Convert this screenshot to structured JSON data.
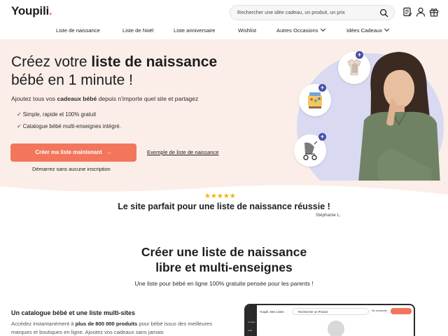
{
  "header": {
    "logo": "Youpili",
    "logo_dot": ".",
    "search_placeholder": "Rechercher une idée cadeau, un produit, un prix",
    "icons": [
      "search-icon",
      "list-icon",
      "user-icon",
      "gift-icon"
    ]
  },
  "nav": {
    "items": [
      {
        "label": "Liste de naissance"
      },
      {
        "label": "Liste de Noël"
      },
      {
        "label": "Liste anniversaire"
      },
      {
        "label": "Wishlist"
      },
      {
        "label": "Autres Occasions",
        "dropdown": true
      },
      {
        "label": "Idées Cadeaux",
        "dropdown": true
      }
    ]
  },
  "hero": {
    "title_pre": "Créez votre ",
    "title_bold": "liste de naissance",
    "title_line2": "bébé en 1 minute !",
    "sub_pre": "Ajoutez tous vos ",
    "sub_bold": "cadeaux bébé",
    "sub_post": " depuis n'importe quel site et partagez",
    "checks": [
      "✓ Simple, rapide et 100% gratuit",
      "✓ Catalogue bébé multi-enseignes intégré."
    ],
    "cta_label": "Créer ma liste maintenant",
    "cta_arrow": "→",
    "example_link": "Exemple de liste de naissance",
    "no_signup": "Démarrez sans aucune inscription",
    "plus_sign": "+",
    "colors": {
      "accent": "#f2765c",
      "hero_bg": "#fbeee9",
      "circle": "#d9d9f2",
      "plus": "#4a4fa8"
    }
  },
  "review": {
    "stars": "★★★★★",
    "rating": 5,
    "text": "Le site parfait pour une liste de naissance réussie !",
    "author": "Stéphanie L."
  },
  "section2": {
    "title_line1": "Créer une liste de naissance",
    "title_line2": "libre et multi-enseignes",
    "subtitle": "Une liste pour bébé en ligne 100% gratuite pensée pour les parents !"
  },
  "catalog": {
    "title": "Un catalogue bébé et une liste multi-sites",
    "text_pre": "Accédez instantanément à ",
    "text_bold": "plus de 800 000 produits",
    "text_post": " pour bébé issus des meilleures marques et boutiques en ligne. Ajoutez vos cadeaux sans jamais"
  },
  "mockup": {
    "logo": "Youpili.  Mes Listes",
    "search": "Rechercher un Produit",
    "connect": "Se connecter",
    "side_tabs": [
      "Compte",
      "Liste"
    ]
  }
}
